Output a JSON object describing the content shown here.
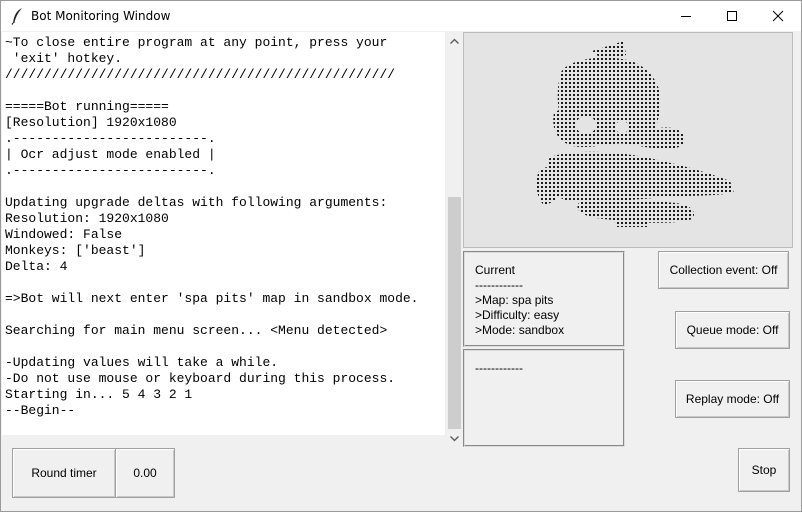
{
  "window": {
    "title": "Bot Monitoring Window",
    "icon": "feather-icon"
  },
  "console": {
    "lines": [
      "~To close entire program at any point, press your",
      " 'exit' hotkey.",
      "//////////////////////////////////////////////////",
      "",
      "=====Bot running=====",
      "[Resolution] 1920x1080",
      ".-------------------------.",
      "| Ocr adjust mode enabled |",
      ".-------------------------.",
      "",
      "Updating upgrade deltas with following arguments:",
      "Resolution: 1920x1080",
      "Windowed: False",
      "Monkeys: ['beast']",
      "Delta: 4",
      "",
      "=>Bot will next enter 'spa pits' map in sandbox mode.",
      "",
      "Searching for main menu screen... <Menu detected>",
      "",
      "-Updating values will take a while.",
      "-Do not use mouse or keyboard during this process.",
      "Starting in... 5 4 3 2 1",
      "--Begin--"
    ]
  },
  "current_info": {
    "heading": "Current",
    "divider": "------------",
    "map": ">Map: spa pits",
    "difficulty": ">Difficulty: easy",
    "mode": ">Mode: sandbox"
  },
  "secondary_info": {
    "divider": "------------"
  },
  "buttons": {
    "collection_event": "Collection event: Off",
    "queue_mode": "Queue mode: Off",
    "replay_mode": "Replay mode: Off",
    "stop": "Stop"
  },
  "round_timer": {
    "label": "Round timer",
    "value": "0.00"
  }
}
